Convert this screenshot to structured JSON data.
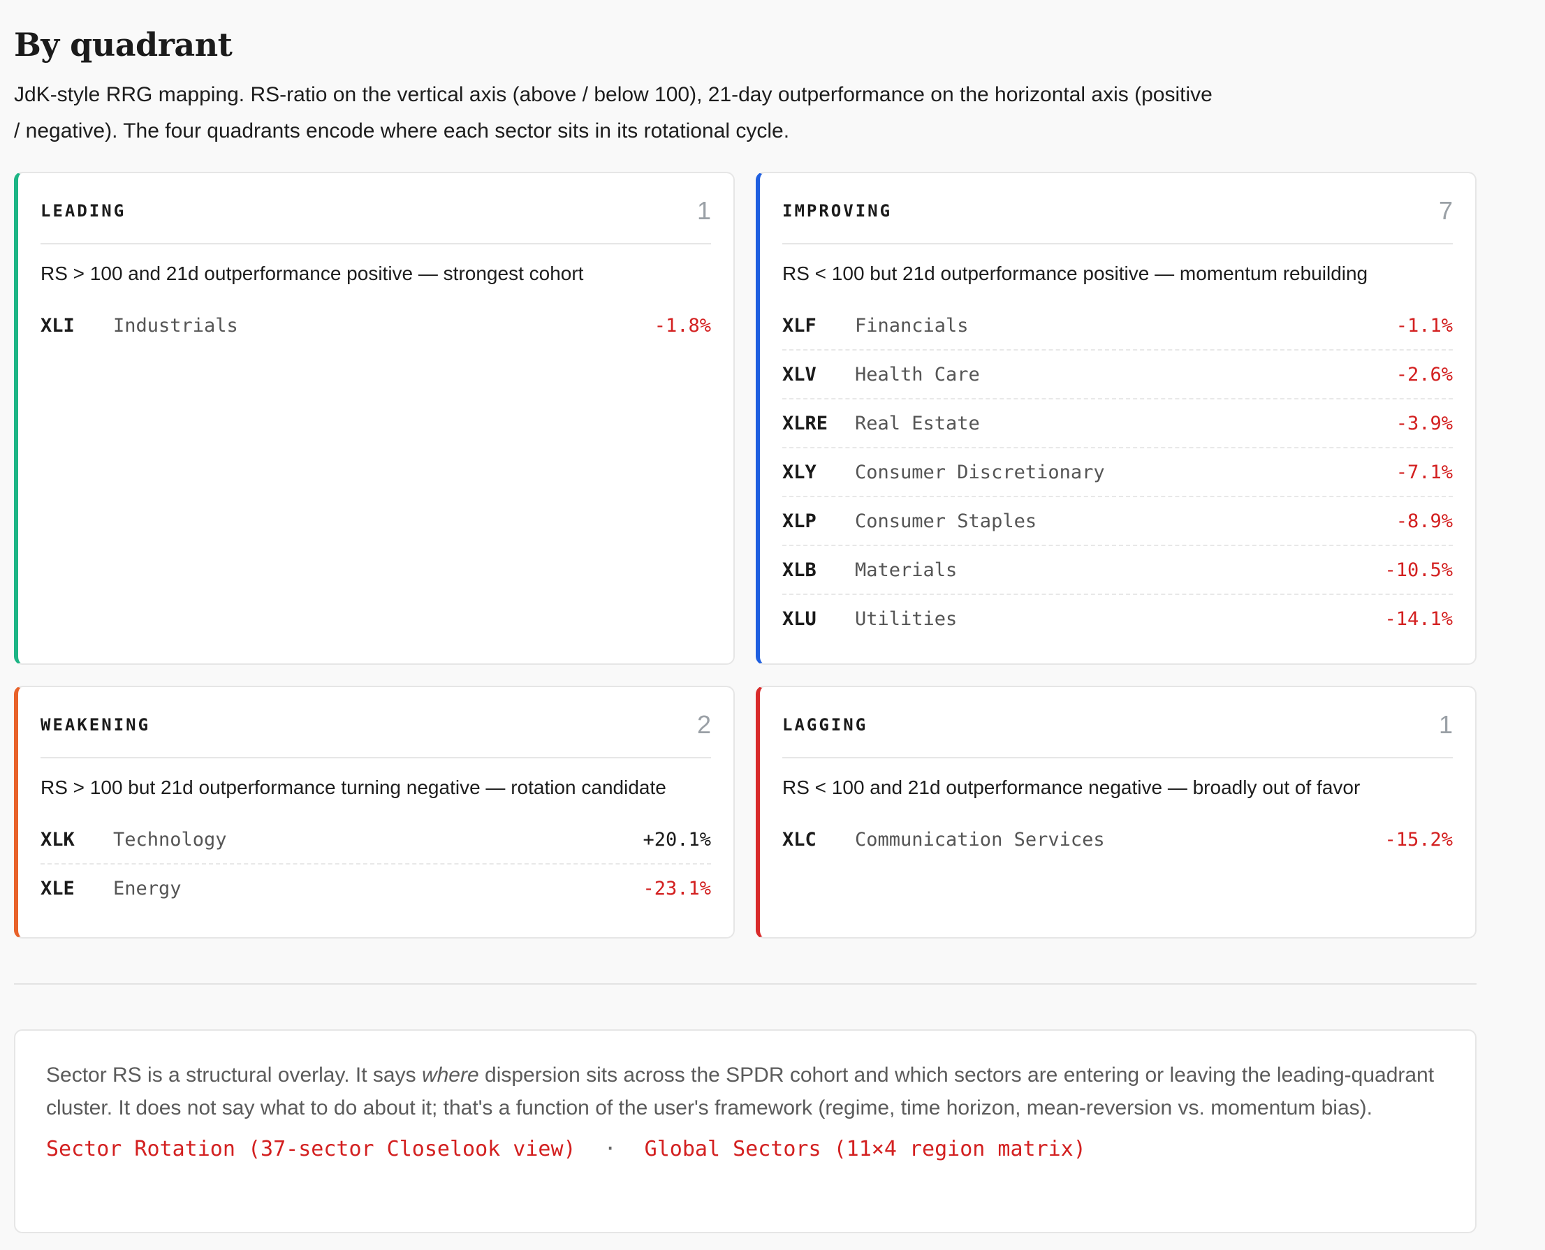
{
  "heading": "By quadrant",
  "intro": "JdK-style RRG mapping. RS-ratio on the vertical axis (above / below 100), 21-day outperformance on the horizontal axis (positive / negative). The four quadrants encode where each sector sits in its rotational cycle.",
  "quadrants": [
    {
      "title": "LEADING",
      "count": "1",
      "accent": "#1db585",
      "desc": "RS > 100 and 21d outperformance positive — strongest cohort",
      "rows": [
        {
          "ticker": "XLI",
          "name": "Industrials",
          "change": "-1.8%"
        }
      ]
    },
    {
      "title": "IMPROVING",
      "count": "7",
      "accent": "#1f5fe0",
      "desc": "RS < 100 but 21d outperformance positive — momentum rebuilding",
      "rows": [
        {
          "ticker": "XLF",
          "name": "Financials",
          "change": "-1.1%"
        },
        {
          "ticker": "XLV",
          "name": "Health Care",
          "change": "-2.6%"
        },
        {
          "ticker": "XLRE",
          "name": "Real Estate",
          "change": "-3.9%"
        },
        {
          "ticker": "XLY",
          "name": "Consumer Discretionary",
          "change": "-7.1%"
        },
        {
          "ticker": "XLP",
          "name": "Consumer Staples",
          "change": "-8.9%"
        },
        {
          "ticker": "XLB",
          "name": "Materials",
          "change": "-10.5%"
        },
        {
          "ticker": "XLU",
          "name": "Utilities",
          "change": "-14.1%"
        }
      ]
    },
    {
      "title": "WEAKENING",
      "count": "2",
      "accent": "#e8622a",
      "desc": "RS > 100 but 21d outperformance turning negative — rotation candidate",
      "rows": [
        {
          "ticker": "XLK",
          "name": "Technology",
          "change": "+20.1%"
        },
        {
          "ticker": "XLE",
          "name": "Energy",
          "change": "-23.1%"
        }
      ]
    },
    {
      "title": "LAGGING",
      "count": "1",
      "accent": "#d92b2b",
      "desc": "RS < 100 and 21d outperformance negative — broadly out of favor",
      "rows": [
        {
          "ticker": "XLC",
          "name": "Communication Services",
          "change": "-15.2%"
        }
      ]
    }
  ],
  "note": {
    "before": "Sector RS is a structural overlay. It says ",
    "emph": "where",
    "after": " dispersion sits across the SPDR cohort and which sectors are entering or leaving the leading-quadrant cluster. It does not say what to do about it; that's a function of the user's framework (regime, time horizon, mean-reversion vs. momentum bias).",
    "link1": "Sector Rotation (37-sector Closelook view)",
    "separator": "·",
    "link2": "Global Sectors (11×4 region matrix)"
  },
  "colors": {
    "negative": "#d32020",
    "positive": "#1a1a1a"
  }
}
